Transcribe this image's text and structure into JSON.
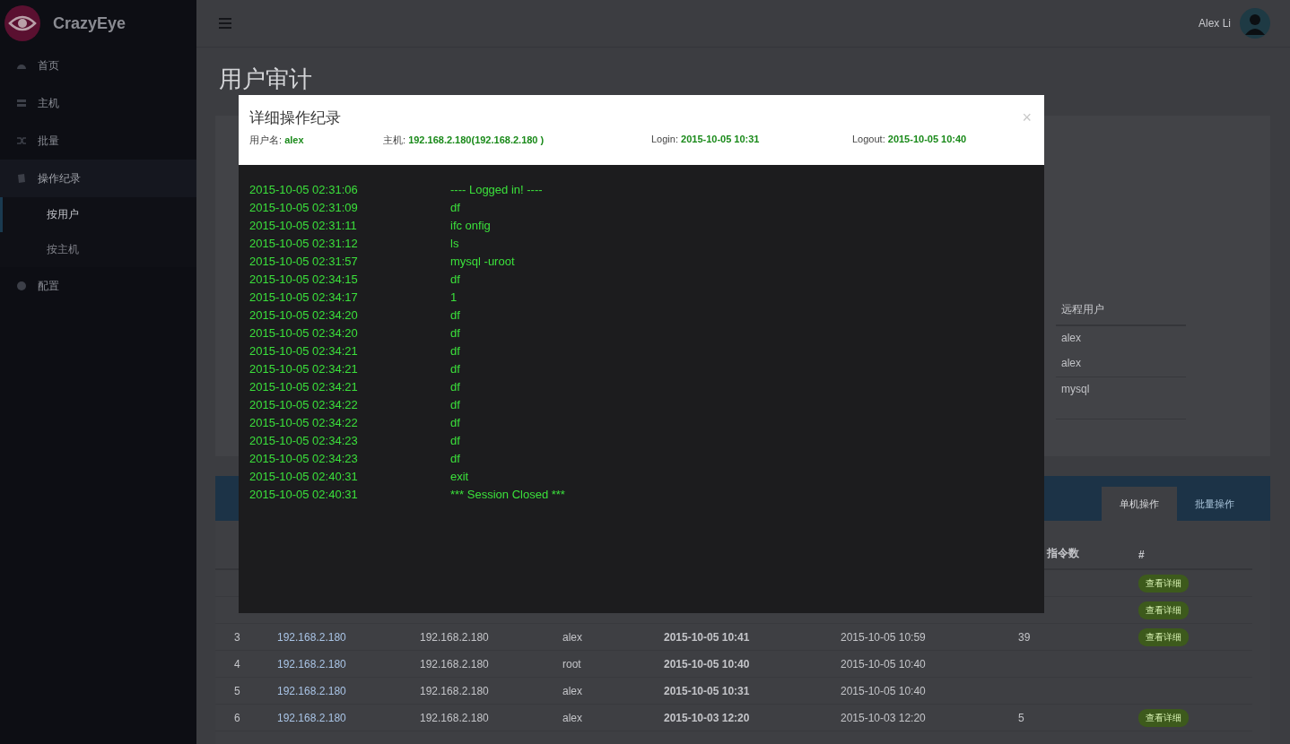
{
  "sidebar": {
    "brand": "CrazyEye",
    "items": [
      {
        "label": "首页"
      },
      {
        "label": "主机"
      },
      {
        "label": "批量"
      },
      {
        "label": "操作纪录",
        "expanded": true,
        "children": [
          {
            "label": "按用户",
            "selected": true
          },
          {
            "label": "按主机",
            "selected": false
          }
        ]
      },
      {
        "label": "配置"
      }
    ]
  },
  "header": {
    "user_name": "Alex Li"
  },
  "page_title": "用户审计",
  "remote_users": {
    "column": "远程用户",
    "rows": [
      "alex",
      "alex",
      "mysql"
    ]
  },
  "tabs": [
    {
      "label": "单机操作",
      "selected": true
    },
    {
      "label": "批量操作",
      "selected": false
    }
  ],
  "table": {
    "columns": [
      "指令数",
      "#"
    ],
    "rows": [
      {
        "button": "查看详细"
      },
      {
        "button": "查看详细"
      },
      {
        "cells": [
          "3",
          "192.168.2.180",
          "192.168.2.180",
          "alex",
          "2015-10-05 10:41",
          "2015-10-05 10:59",
          "39"
        ],
        "button": "查看详细"
      },
      {
        "cells": [
          "4",
          "192.168.2.180",
          "192.168.2.180",
          "root",
          "2015-10-05 10:40",
          "2015-10-05 10:40"
        ]
      },
      {
        "cells": [
          "5",
          "192.168.2.180",
          "192.168.2.180",
          "alex",
          "2015-10-05 10:31",
          "2015-10-05 10:40"
        ]
      },
      {
        "cells": [
          "6",
          "192.168.2.180",
          "192.168.2.180",
          "alex",
          "2015-10-03 12:20",
          "2015-10-03 12:20",
          "5"
        ],
        "button": "查看详细"
      }
    ]
  },
  "modal": {
    "title": "详细操作纪录",
    "close": "×",
    "fields": [
      {
        "label": "用户名:",
        "value": "alex"
      },
      {
        "label": "主机:",
        "value": "192.168.2.180(192.168.2.180 )"
      },
      {
        "label": "Login:",
        "value": "2015-10-05 10:31"
      },
      {
        "label": "Logout:",
        "value": "2015-10-05 10:40"
      }
    ],
    "log": [
      {
        "time": "2015-10-05 02:31:06",
        "command": "---- Logged in! ----"
      },
      {
        "time": "2015-10-05 02:31:09",
        "command": "df"
      },
      {
        "time": "2015-10-05 02:31:11",
        "command": "ifc onfig"
      },
      {
        "time": "2015-10-05 02:31:12",
        "command": "ls"
      },
      {
        "time": "2015-10-05 02:31:57",
        "command": "mysql -uroot"
      },
      {
        "time": "2015-10-05 02:34:15",
        "command": "df"
      },
      {
        "time": "2015-10-05 02:34:17",
        "command": "1"
      },
      {
        "time": "2015-10-05 02:34:20",
        "command": "df"
      },
      {
        "time": "2015-10-05 02:34:20",
        "command": "df"
      },
      {
        "time": "2015-10-05 02:34:21",
        "command": "df"
      },
      {
        "time": "2015-10-05 02:34:21",
        "command": "df"
      },
      {
        "time": "2015-10-05 02:34:21",
        "command": "df"
      },
      {
        "time": "2015-10-05 02:34:22",
        "command": "df"
      },
      {
        "time": "2015-10-05 02:34:22",
        "command": "df"
      },
      {
        "time": "2015-10-05 02:34:23",
        "command": "df"
      },
      {
        "time": "2015-10-05 02:34:23",
        "command": "df"
      },
      {
        "time": "2015-10-05 02:40:31",
        "command": "exit"
      },
      {
        "time": "2015-10-05 02:40:31",
        "command": "*** Session Closed ***"
      }
    ]
  }
}
